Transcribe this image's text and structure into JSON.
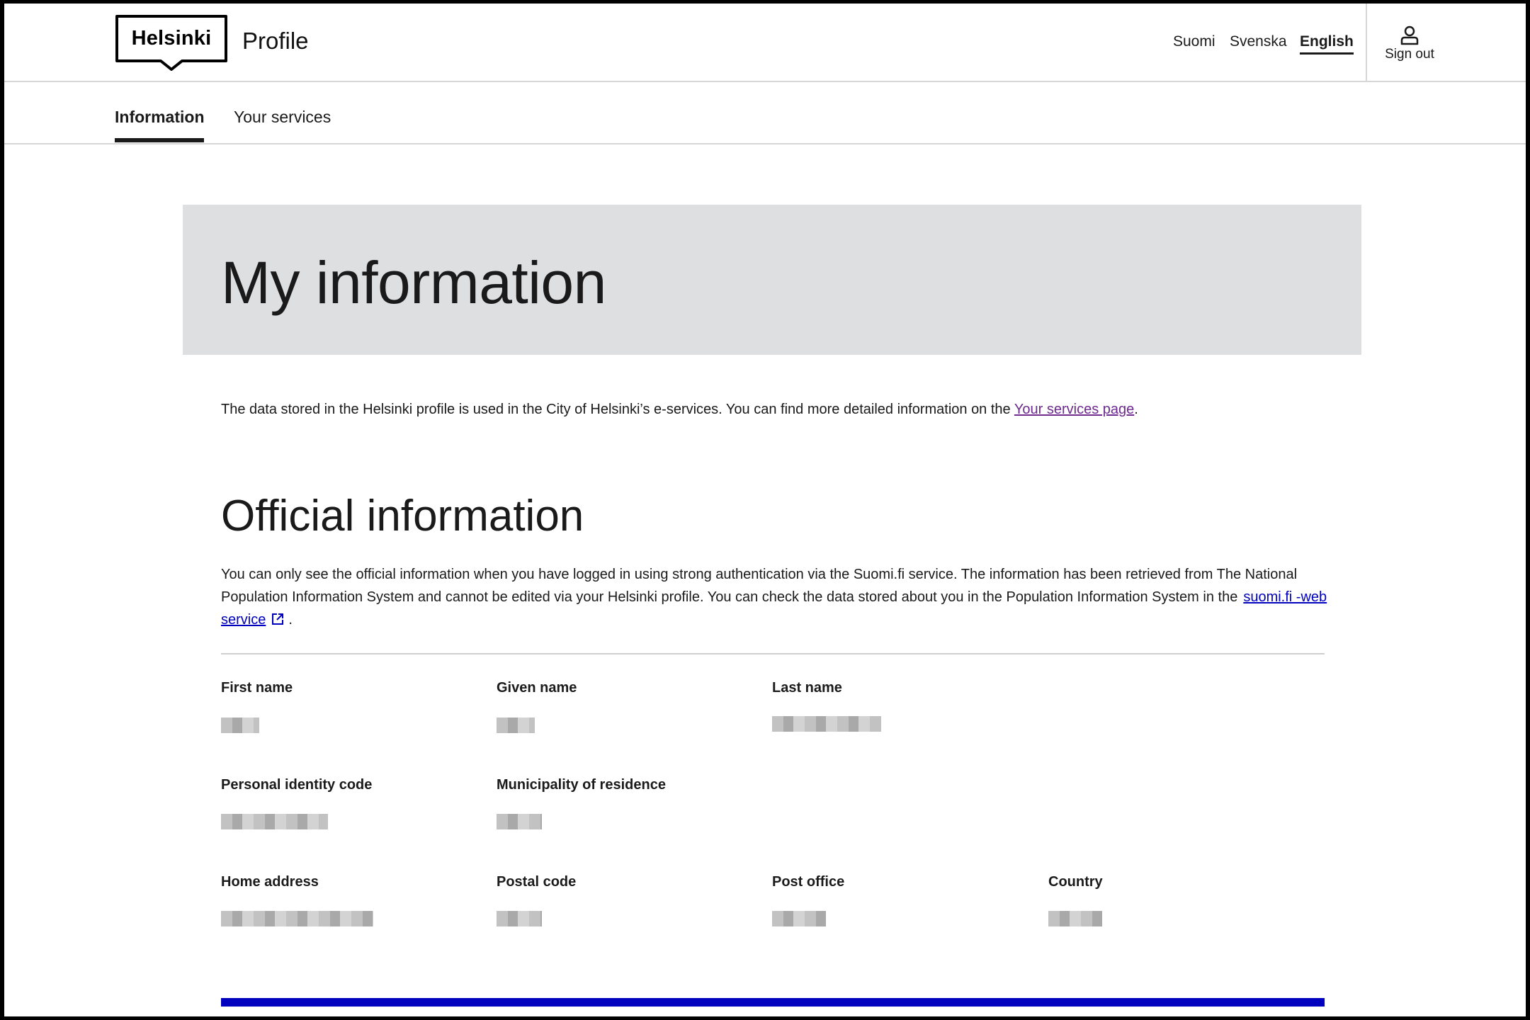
{
  "header": {
    "logo_text": "Helsinki",
    "app_name": "Profile",
    "languages": [
      "Suomi",
      "Svenska",
      "English"
    ],
    "active_language": "English",
    "sign_out_label": "Sign out"
  },
  "tabs": [
    {
      "label": "Information",
      "active": true
    },
    {
      "label": "Your services",
      "active": false
    }
  ],
  "hero": {
    "title": "My information"
  },
  "intro": {
    "text": "The data stored in the Helsinki profile is used in the City of Helsinki’s e-services. You can find more detailed information on the ",
    "link_text": "Your services page",
    "suffix": "."
  },
  "official": {
    "title": "Official information",
    "description": "You can only see the official information when you have logged in using strong authentication via the Suomi.fi service. The information has been retrieved from The National Population Information System and cannot be edited via your Helsinki profile. You can check the data stored about you in the Population Information System in the",
    "link_text": "suomi.fi -web service",
    "suffix": ".",
    "fields": {
      "first_name": "First name",
      "given_name": "Given name",
      "last_name": "Last name",
      "personal_identity_code": "Personal identity code",
      "municipality": "Municipality of residence",
      "home_address": "Home address",
      "postal_code": "Postal code",
      "post_office": "Post office",
      "country": "Country"
    }
  },
  "colors": {
    "accent_bar": "#0000bf",
    "hero_bg": "#dedfe1",
    "visited_link": "#6e2a8f"
  }
}
